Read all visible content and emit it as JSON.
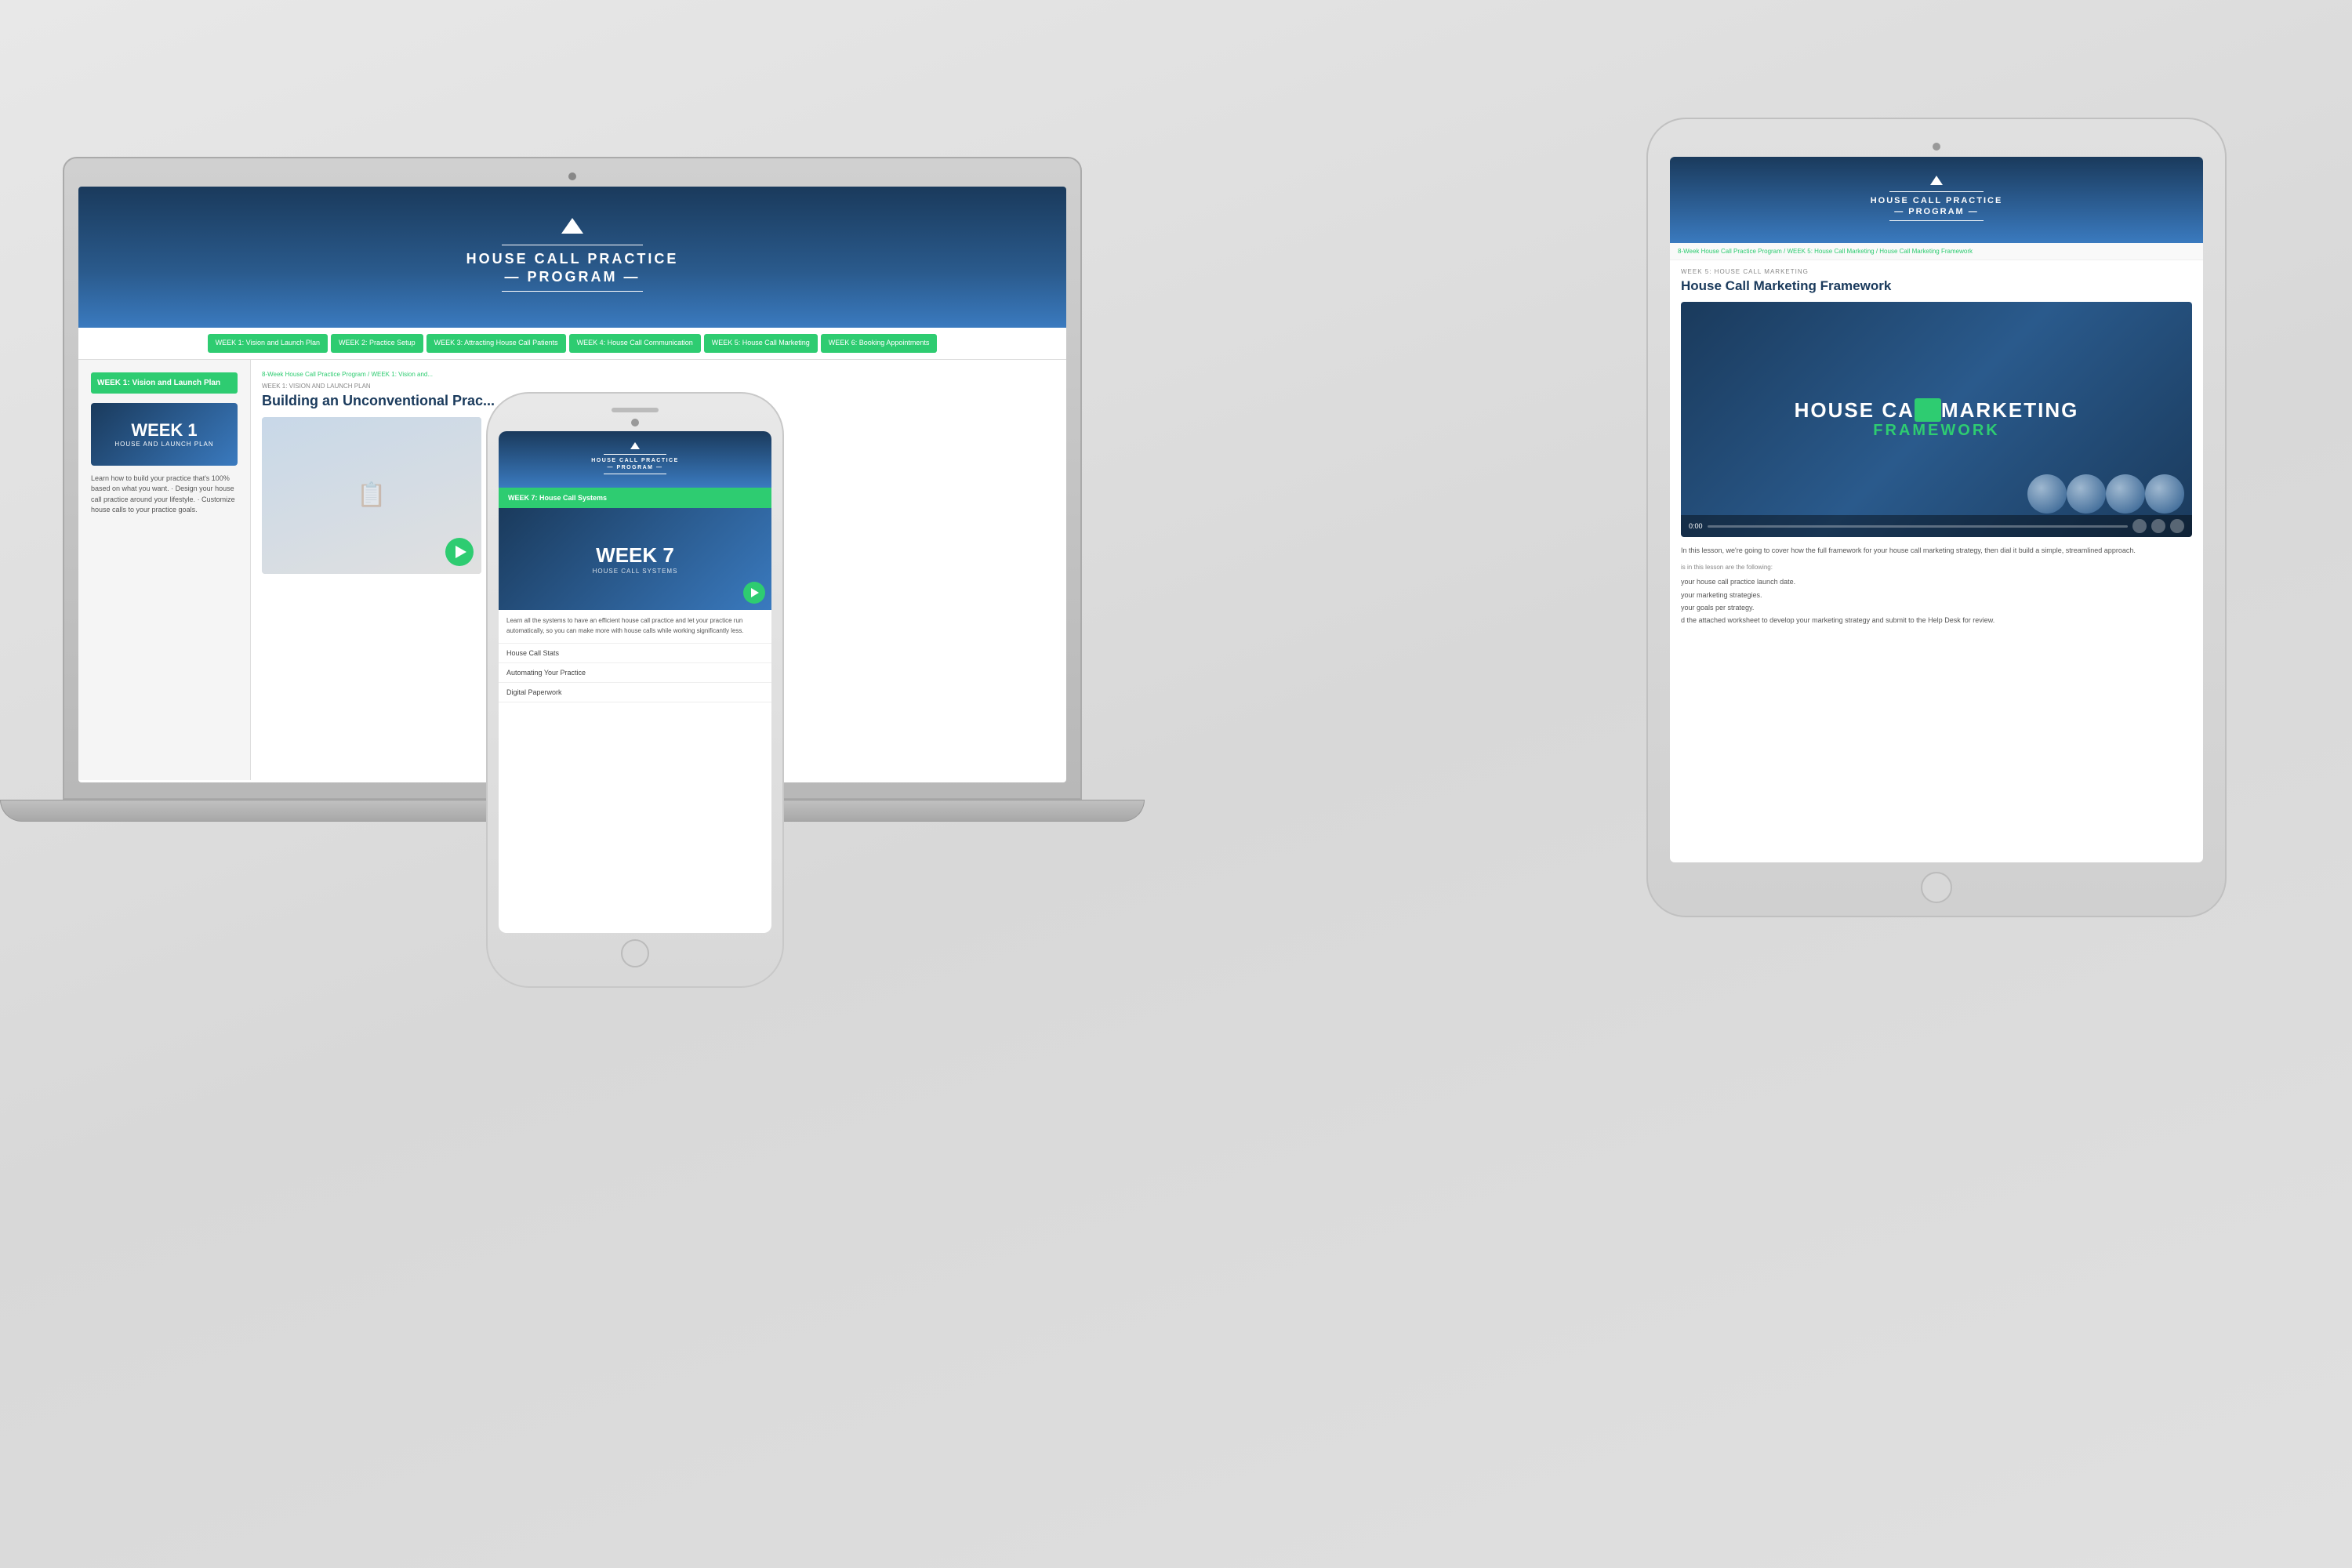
{
  "background": {
    "color": "#ddd"
  },
  "laptop": {
    "logo_line1": "HOUSE CALL PRACTICE",
    "logo_line2": "PROGRAM",
    "nav_items": [
      "WEEK 1: Vision and Launch Plan",
      "WEEK 2: Practice Setup",
      "WEEK 3: Attracting House Call Patients",
      "WEEK 4: House Call Communication",
      "WEEK 5: House Call Marketing",
      "WEEK 6: Booking Appointments"
    ],
    "breadcrumb": "8-Week House Call Practice Program / WEEK 1: Vision and...",
    "sidebar_title": "WEEK 1: Vision and Launch Plan",
    "main_title": "Building an Unconventional Prac...",
    "week_label": "WEEK 1",
    "week_sublabel": "HOUSE AND LAUNCH PLAN",
    "sidebar_body": "Learn how to build your practice that's 100% based on what you want. · Design your house call practice around your lifestyle. · Customize house calls to your practice goals.",
    "week_breadcrumb": "WEEK 1: VISION AND LAUNCH PLAN"
  },
  "tablet": {
    "logo_line1": "HOUSE CALL PRACTICE",
    "logo_line2": "PROGRAM",
    "breadcrumb": "8-Week House Call Practice Program / WEEK 5: House Call Marketing / House Call Marketing Framework",
    "week_label": "WEEK 5: HOUSE CALL MARKETING",
    "title": "House Call Marketing Framework",
    "video_title_part1": "HOUSE CA",
    "video_title_play": "▶",
    "video_title_part2": "MARKETING",
    "video_subtitle": "FRAMEWORK",
    "desc_text": "In this lesson, we're going to cover how the full framework for your house call marketing strategy, then dial it build a simple, streamlined approach.",
    "goals_label": "is in this lesson are the following:",
    "goal1": "your house call practice launch date.",
    "goal2": "your marketing strategies.",
    "goal3": "your goals per strategy.",
    "goal4": "d the attached worksheet to develop your marketing strategy and submit to the Help Desk for review."
  },
  "phone": {
    "logo_line1": "HOUSE CALL PRACTICE",
    "logo_line2": "PROGRAM",
    "week_bar": "WEEK 7: House Call Systems",
    "week_number": "WEEK 7",
    "week_sublabel": "HOUSE CALL SYSTEMS",
    "desc": "Learn all the systems to have an efficient house call practice and let your practice run automatically, so you can make more with house calls while working significantly less.",
    "list_items": [
      "House Call Stats",
      "Automating Your Practice",
      "Digital Paperwork"
    ]
  }
}
